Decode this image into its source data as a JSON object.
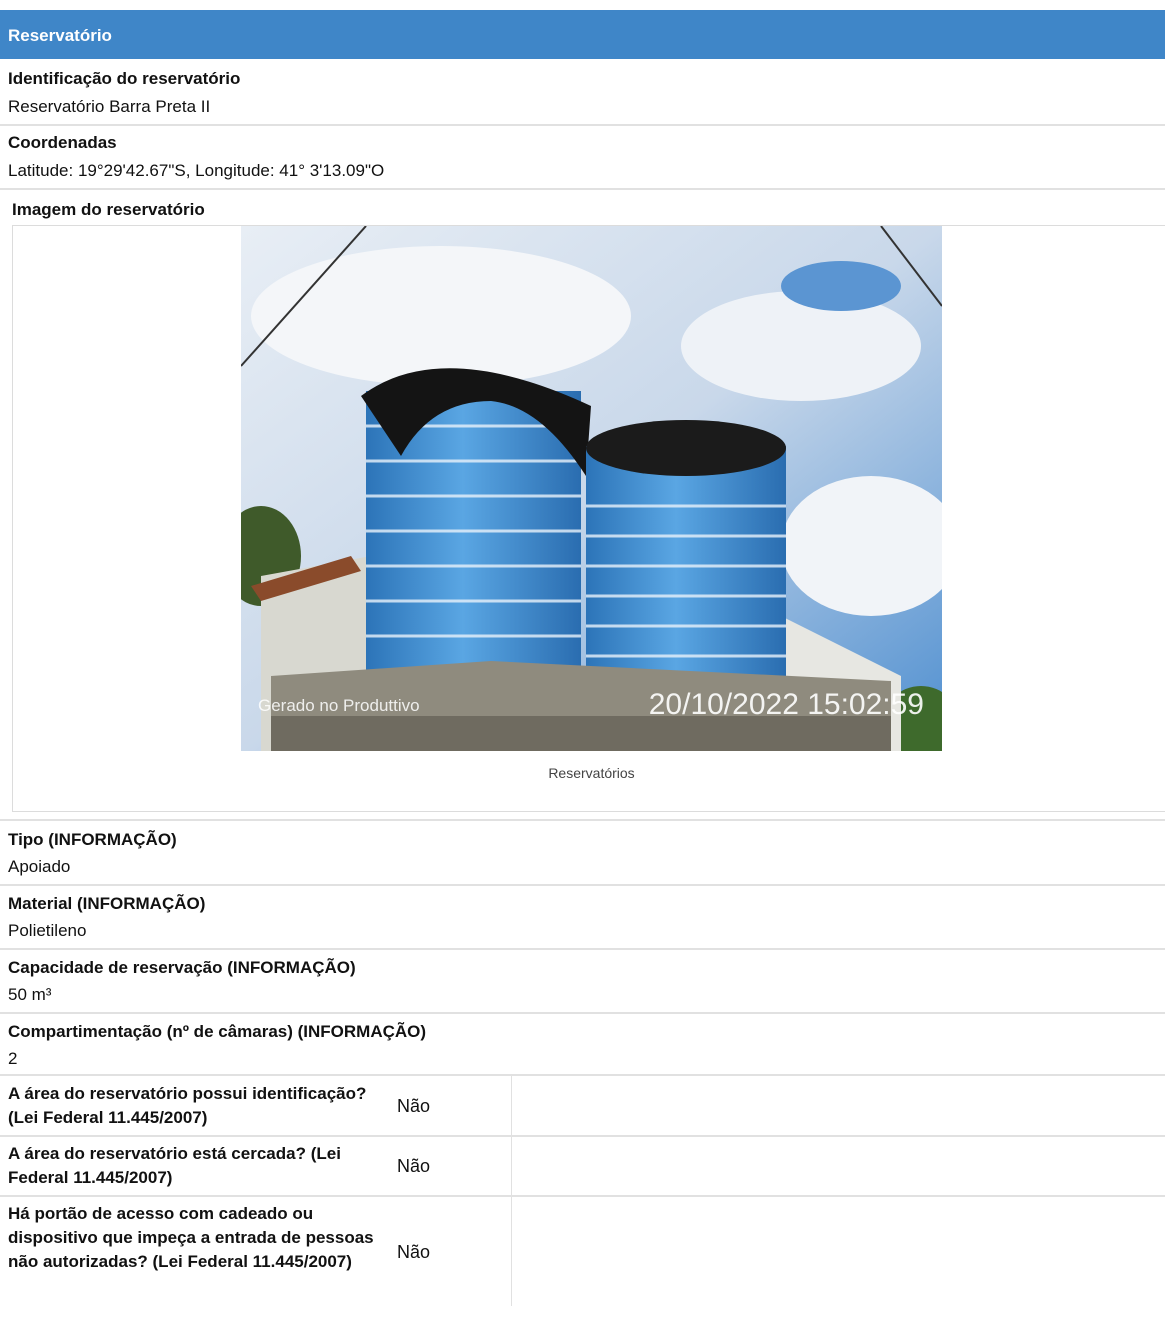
{
  "section": {
    "title": "Reservatório"
  },
  "fields": [
    {
      "label": "Identificação do reservatório",
      "value": "Reservatório Barra Preta II"
    },
    {
      "label": "Coordenadas",
      "value": "Latitude: 19°29'42.67\"S, Longitude: 41° 3'13.09\"O"
    }
  ],
  "image_section": {
    "label": "Imagem do reservatório",
    "caption": "Reservatórios",
    "photo_watermark": "Gerado no Produttivo",
    "photo_datetime": "20/10/2022 15:02:59",
    "photo_subject": "Two blue polyethylene water tanks on a concrete base",
    "colors": {
      "sky": "#4a86c8",
      "tank": "#3f8fd1",
      "cover": "#1a1a1a"
    }
  },
  "info_fields": [
    {
      "label": "Tipo (INFORMAÇÃO)",
      "value": "Apoiado"
    },
    {
      "label": "Material (INFORMAÇÃO)",
      "value": "Polietileno"
    },
    {
      "label": "Capacidade de reservação (INFORMAÇÃO)",
      "value": "50 m³"
    },
    {
      "label": "Compartimentação (nº de câmaras) (INFORMAÇÃO)",
      "value": "2"
    }
  ],
  "questions": [
    {
      "text": "A área do reservatório possui identificação? (Lei Federal 11.445/2007)",
      "answer": "Não"
    },
    {
      "text": "A área do reservatório está cercada? (Lei Federal 11.445/2007)",
      "answer": "Não"
    },
    {
      "text": "Há portão de acesso com cadeado ou dispositivo que impeça a entrada de pessoas não autorizadas? (Lei Federal 11.445/2007)",
      "answer": "Não"
    }
  ],
  "theme": {
    "header_bg": "#3f86c8",
    "separator": "#e1e1e1"
  }
}
